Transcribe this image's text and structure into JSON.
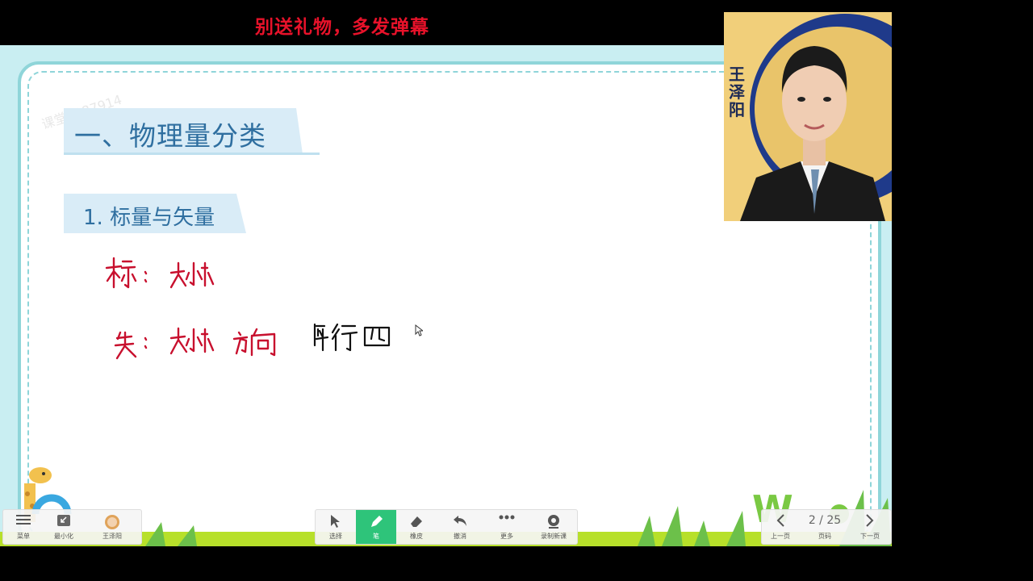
{
  "banner": {
    "text": "别送礼物，多发弹幕"
  },
  "slide": {
    "watermark": "课堂4087914",
    "heading": "一、物理量分类",
    "subheading": "1. 标量与矢量"
  },
  "webcam": {
    "teacher_name": "王泽阳"
  },
  "toolbar_left": {
    "menu_label": "菜单",
    "minimize_label": "最小化",
    "teacher_label": "王泽阳"
  },
  "toolbar_mid": {
    "select_label": "选择",
    "pen_label": "笔",
    "eraser_label": "橡皮",
    "undo_label": "撤消",
    "more_label": "更多",
    "record_label": "录制新课"
  },
  "toolbar_right": {
    "prev_label": "上一页",
    "page_label": "页码",
    "next_label": "下一页",
    "page_indicator": "2 / 25"
  },
  "colors": {
    "accent_green": "#2ec47a",
    "heading_blue": "#2f6fa0",
    "banner_red": "#e8122a"
  }
}
